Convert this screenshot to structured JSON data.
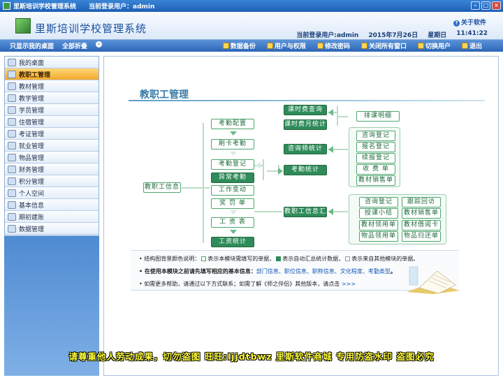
{
  "window": {
    "title": "里斯培训学校管理系统",
    "current_user": "当前登录用户：admin"
  },
  "header": {
    "app_title": "里斯培训学校管理系统",
    "about": "关于软件",
    "login_user": "当前登录用户:admin",
    "date": "2015年7月26日",
    "weekday": "星期日",
    "time": "11:41:22"
  },
  "toolbar": {
    "show_desktop": "只显示我的桌面",
    "collapse_all": "全部折叠",
    "items": [
      {
        "label": "数据备份",
        "icon": "database-icon"
      },
      {
        "label": "用户与权限",
        "icon": "users-icon"
      },
      {
        "label": "修改密码",
        "icon": "key-icon"
      },
      {
        "label": "关闭所有窗口",
        "icon": "close-windows-icon"
      },
      {
        "label": "切换用户",
        "icon": "switch-user-icon"
      },
      {
        "label": "退出",
        "icon": "exit-icon"
      }
    ]
  },
  "sidebar": {
    "items": [
      "我的桌面",
      "教职工管理",
      "教材管理",
      "教学管理",
      "学员管理",
      "住宿管理",
      "考证管理",
      "就业管理",
      "物品管理",
      "财务管理",
      "积分管理",
      "个人空间",
      "基本信息",
      "期初建账",
      "数据管理"
    ],
    "active_index": 1
  },
  "main": {
    "title": "教职工管理",
    "flow": {
      "info": "教职工信息",
      "chain": [
        "考勤配置",
        "刷卡考勤",
        "考勤登记",
        "异常考勤",
        "工作变动",
        "奖 罚 单",
        "工 资 表"
      ],
      "wage_stats": "工资统计",
      "attendance_stats": "考勤统计",
      "staff_summary": "教职工信息汇总",
      "consultant_stats": "咨询师统计",
      "fee_query": "课时费查询",
      "fee_month": "课时费月统计",
      "schedule": "排课明细",
      "group_mid": [
        "咨询登记",
        "报名登记",
        "续报登记",
        "收 费 单",
        "教材销售单"
      ],
      "group_bottom": [
        [
          "咨询登记",
          "跟踪回访"
        ],
        [
          "授课小结",
          "教材销售单"
        ],
        [
          "教材领用单",
          "教材借阅卡"
        ],
        [
          "物品领用单",
          "物品归还单"
        ]
      ]
    },
    "legend": {
      "l1_prefix": "结构图背景颜色说明：",
      "l1_a": "表示本模块需填写的单据，",
      "l1_b": "表示自动汇总统计数据，",
      "l1_c": "表示来自其他模块的单据。",
      "l2_prefix": "在使用本模块之前请先填写相应的基本信息：",
      "l2_links": "部门信息、职位信息、职称信息、文化程度、考勤类型",
      "l2_end": "。",
      "l3": "如需更多帮助，请通过以下方式联系；如需了解《师之伴侣》其他版本，请点击",
      "l3_link": ">>>"
    }
  },
  "watermark": "请尊重他人劳动成果，切勿盗图 旺旺:ljjdtbwz 里斯软件商城 专用防盗水印 盗图必究",
  "colors": {
    "accent": "#2f8b5a",
    "light_green": "#4ea56f",
    "blue": "#2c66b8"
  }
}
